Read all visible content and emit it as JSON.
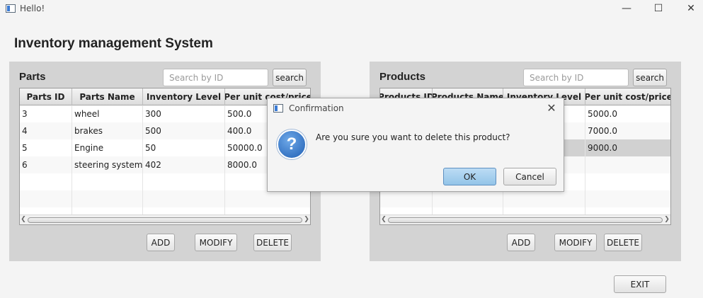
{
  "window": {
    "title": "Hello!",
    "controls": [
      "—",
      "☐",
      "✕"
    ]
  },
  "app": {
    "heading": "Inventory management System"
  },
  "parts_panel": {
    "title": "Parts",
    "search_placeholder": "Search by ID",
    "search_label": "search",
    "columns": [
      "Parts ID",
      "Parts Name",
      "Inventory Level",
      "Per unit cost/price"
    ],
    "rows": [
      [
        "3",
        "wheel",
        "300",
        "500.0"
      ],
      [
        "4",
        "brakes",
        "500",
        "400.0"
      ],
      [
        "5",
        "Engine",
        "50",
        "50000.0"
      ],
      [
        "6",
        "steering system",
        "402",
        "8000.0"
      ],
      [
        "",
        "",
        "",
        ""
      ],
      [
        "",
        "",
        "",
        ""
      ],
      [
        "",
        "",
        "",
        ""
      ]
    ],
    "buttons": {
      "add": "ADD",
      "modify": "MODIFY",
      "delete": "DELETE"
    }
  },
  "products_panel": {
    "title": "Products",
    "search_placeholder": "Search by ID",
    "search_label": "search",
    "columns": [
      "Products ID",
      "Products Name",
      "Inventory Level",
      "Per unit cost/price"
    ],
    "rows": [
      [
        "",
        "",
        "",
        "5000.0"
      ],
      [
        "",
        "",
        "",
        "7000.0"
      ],
      [
        "",
        "",
        "",
        "9000.0"
      ],
      [
        "",
        "",
        "",
        ""
      ],
      [
        "",
        "",
        "",
        ""
      ],
      [
        "",
        "",
        "",
        ""
      ],
      [
        "",
        "",
        "",
        ""
      ]
    ],
    "selected_row": 2,
    "buttons": {
      "add": "ADD",
      "modify": "MODIFY",
      "delete": "DELETE"
    }
  },
  "exit_label": "EXIT",
  "dialog": {
    "title": "Confirmation",
    "close": "✕",
    "icon": "?",
    "message": "Are you sure you want to delete this product?",
    "ok_label": "OK",
    "cancel_label": "Cancel"
  }
}
